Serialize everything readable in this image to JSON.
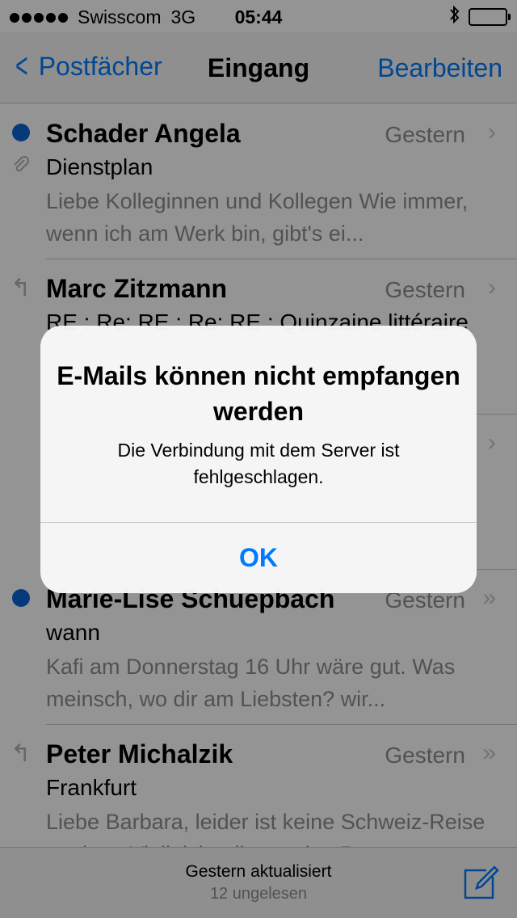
{
  "status_bar": {
    "carrier": "Swisscom",
    "network": "3G",
    "time": "05:44",
    "bluetooth_icon": "bluetooth-icon",
    "battery_color": "#4cd964"
  },
  "nav": {
    "back_label": "Postfächer",
    "title": "Eingang",
    "edit_label": "Bearbeiten"
  },
  "mails": [
    {
      "sender": "Schader Angela",
      "date": "Gestern",
      "subject": "Dienstplan",
      "preview": "Liebe Kolleginnen und Kollegen Wie immer, wenn ich am Werk bin, gibt's ei...",
      "unread": true,
      "attachment": true,
      "replied": false,
      "chevron": "›"
    },
    {
      "sender": "Marc Zitzmann",
      "date": "Gestern",
      "subject": "RE : Re: RE : Re: RE : Quinzaine littéraire",
      "preview": "",
      "unread": false,
      "attachment": false,
      "replied": true,
      "chevron": "›"
    },
    {
      "sender": "",
      "date": "",
      "subject": "",
      "preview": "",
      "unread": false,
      "attachment": false,
      "replied": false,
      "chevron": "›"
    },
    {
      "sender": "Marie-Lise Schuepbach",
      "date": "Gestern",
      "subject": "wann",
      "preview": "Kafi am Donnerstag 16 Uhr wäre gut. Was meinsch, wo dir am Liebsten? wir...",
      "unread": true,
      "attachment": false,
      "replied": false,
      "chevron": "»"
    },
    {
      "sender": "Peter Michalzik",
      "date": "Gestern",
      "subject": "Frankfurt",
      "preview": "Liebe Barbara, leider ist keine Schweiz-Reise geplant. Vielleicht gibt es eine P...",
      "unread": false,
      "attachment": false,
      "replied": true,
      "chevron": "»"
    }
  ],
  "toolbar": {
    "updated": "Gestern aktualisiert",
    "unread_count": "12 ungelesen",
    "compose_icon": "compose-icon"
  },
  "alert": {
    "title": "E-Mails können nicht empfangen werden",
    "message": "Die Verbindung mit dem Server ist fehlgeschlagen.",
    "ok_label": "OK"
  },
  "colors": {
    "accent": "#007aff",
    "unread_dot": "#0b62d6",
    "secondary_text": "#8e8e93"
  }
}
